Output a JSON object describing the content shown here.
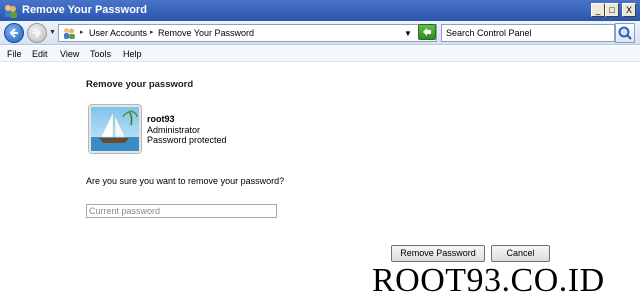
{
  "window": {
    "title": "Remove Your Password",
    "controls": {
      "minimize": "_",
      "maximize": "□",
      "close": "X"
    }
  },
  "address_bar": {
    "crumbs": [
      "User Accounts",
      "Remove Your Password"
    ],
    "search_placeholder": "Search Control Panel"
  },
  "menu": [
    "File",
    "Edit",
    "View",
    "Tools",
    "Help"
  ],
  "content": {
    "heading": "Remove your password",
    "user": {
      "name": "root93",
      "role": "Administrator",
      "status": "Password protected"
    },
    "question": "Are you sure you want to remove your password?",
    "password_placeholder": "Current password",
    "buttons": {
      "remove": "Remove Password",
      "cancel": "Cancel"
    }
  },
  "watermark": "ROOT93.CO.ID",
  "colors": {
    "titlebar": "#2a55b0",
    "address_bg": "#eef3fb"
  }
}
